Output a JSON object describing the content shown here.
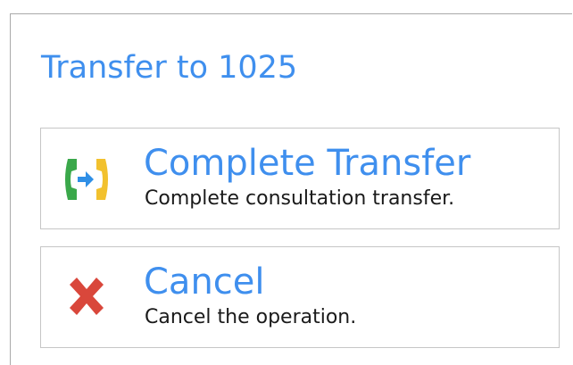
{
  "dialog": {
    "title": "Transfer to 1025"
  },
  "options": [
    {
      "label": "Complete Transfer",
      "description": "Complete consultation transfer.",
      "icon": "complete-transfer-icon"
    },
    {
      "label": "Cancel",
      "description": "Cancel the operation.",
      "icon": "cancel-x-icon"
    }
  ],
  "colors": {
    "accent": "#3f8fee",
    "phone_left": "#3aa84a",
    "phone_right": "#f2c12e",
    "arrow": "#2f8fe6",
    "cancel": "#d9473b"
  }
}
